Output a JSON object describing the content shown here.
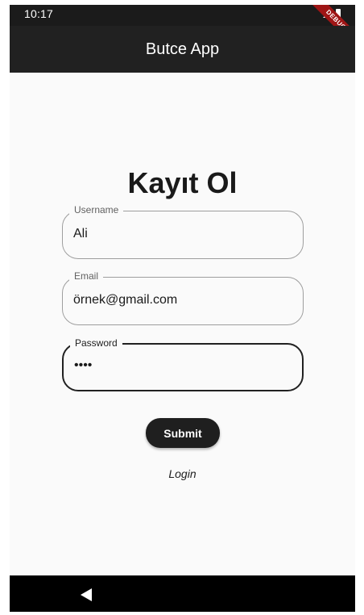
{
  "status_bar": {
    "time": "10:17",
    "debug_label": "DEBUG"
  },
  "app_bar": {
    "title": "Butce App"
  },
  "page": {
    "title": "Kayıt Ol"
  },
  "form": {
    "username": {
      "label": "Username",
      "value": "Ali"
    },
    "email": {
      "label": "Email",
      "value": "örnek@gmail.com"
    },
    "password": {
      "label": "Password",
      "value": "••••",
      "focused": true
    },
    "submit_label": "Submit",
    "login_label": "Login"
  },
  "icons": {
    "back": "back-triangle-icon",
    "signal": "signal-icon",
    "battery": "battery-icon"
  },
  "colors": {
    "app_bar": "#212121",
    "button": "#1f1f1f",
    "debug_banner": "#9e1515",
    "background": "#fafafa"
  }
}
